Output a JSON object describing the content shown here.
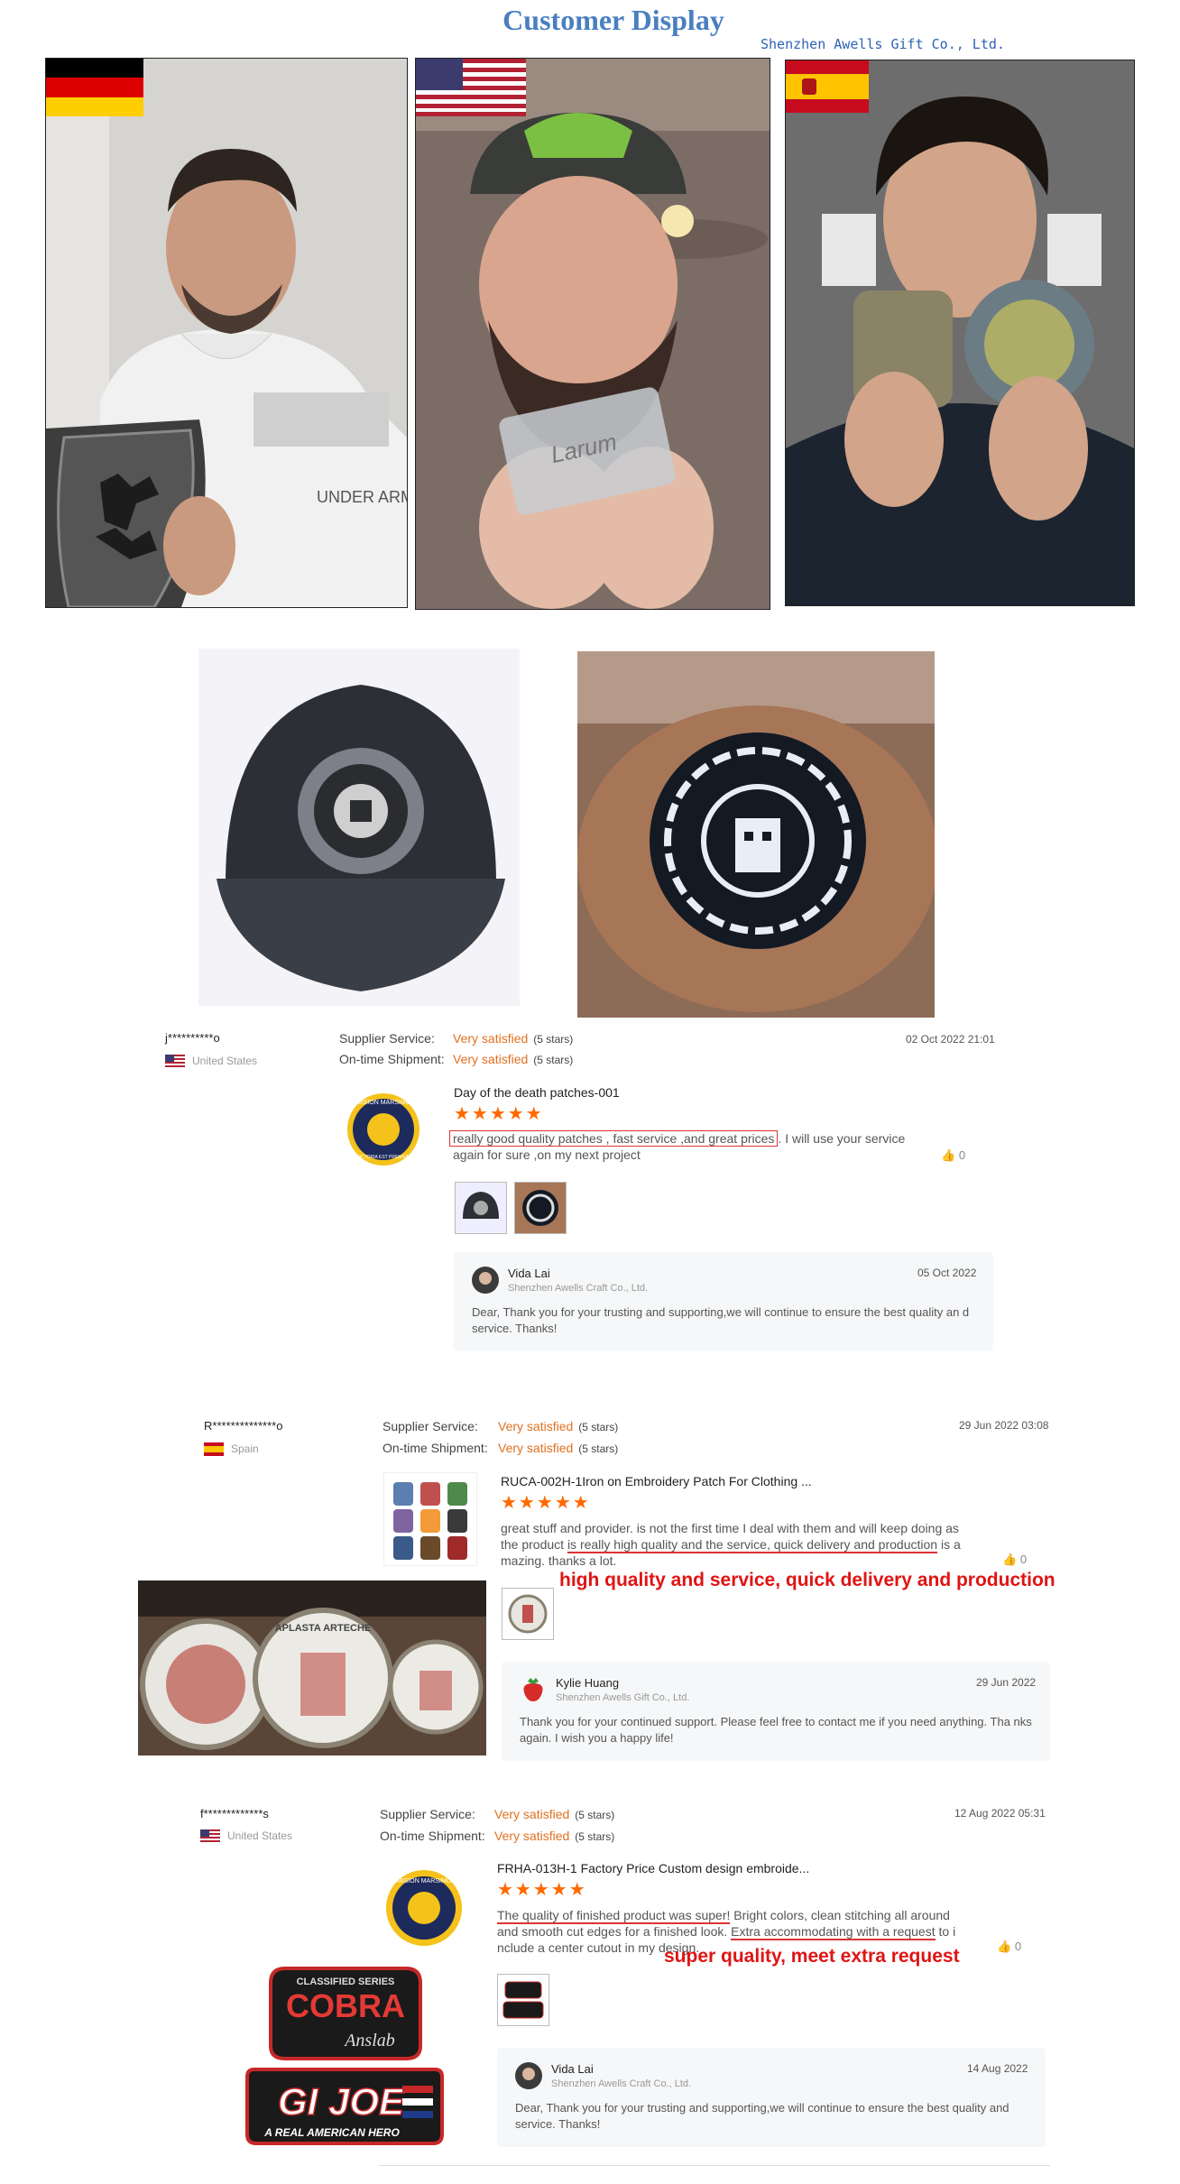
{
  "header": {
    "title": "Customer Display",
    "company": "Shenzhen Awells Gift Co., Ltd."
  },
  "photos": [
    {
      "flag": "germany",
      "shirt_text": "UNDER ARMOUR"
    },
    {
      "flag": "united-states",
      "patch_text": "Larum"
    },
    {
      "flag": "spain"
    }
  ],
  "reviews": [
    {
      "buyer": "j**********o",
      "country": "United States",
      "flag": "united-states",
      "supplier_label": "Supplier Service:",
      "supplier_value": "Very satisfied",
      "supplier_note": "(5 stars)",
      "shipment_label": "On-time Shipment:",
      "shipment_value": "Very satisfied",
      "shipment_note": "(5 stars)",
      "date": "02 Oct 2022 21:01",
      "product": "Day of the death patches-001",
      "stars": "★★★★★",
      "text_highlight": "really good quality patches , fast service ,and great prices",
      "text_rest": ". I will use your  service",
      "text_line2": "again for sure ,on my next project",
      "likes": "0",
      "reply": {
        "name": "Vida Lai",
        "company": "Shenzhen Awells Craft Co., Ltd.",
        "date": "05 Oct 2022",
        "text": "Dear, Thank you for your trusting and supporting,we will continue to ensure the best quality an d service. Thanks!"
      }
    },
    {
      "buyer": "R**************o",
      "country": "Spain",
      "flag": "spain",
      "supplier_label": "Supplier Service:",
      "supplier_value": "Very satisfied",
      "supplier_note": "(5 stars)",
      "shipment_label": "On-time Shipment:",
      "shipment_value": "Very satisfied",
      "shipment_note": "(5 stars)",
      "date": "29 Jun 2022 03:08",
      "product": "RUCA-002H-1Iron on Embroidery Patch For Clothing ...",
      "stars": "★★★★★",
      "text_line1": "great stuff and provider. is not the first time I deal with them and will keep doing as",
      "text_line2_a": "the product ",
      "text_line2_u": "is really high quality and the service, quick delivery and production",
      "text_line2_b": " is a",
      "text_line3": "mazing. thanks a lot.",
      "caption": "high quality and service, quick delivery and production",
      "likes": "0",
      "reply": {
        "name": "Kylie Huang",
        "company": "Shenzhen Awells Gift Co., Ltd.",
        "date": "29 Jun 2022",
        "text": "Thank you for your continued support. Please feel free to contact  me if you need anything. Tha nks again. I wish you a happy life!"
      }
    },
    {
      "buyer": "f*************s",
      "country": "United States",
      "flag": "united-states",
      "supplier_label": "Supplier Service:",
      "supplier_value": "Very satisfied",
      "supplier_note": "(5 stars)",
      "shipment_label": "On-time Shipment:",
      "shipment_value": "Very satisfied",
      "shipment_note": "(5 stars)",
      "date": "12 Aug 2022 05:31",
      "product": "FRHA-013H-1 Factory Price Custom design embroide...",
      "stars": "★★★★★",
      "text_line1_u": "The quality of finished product was super!",
      "text_line1_b": " Bright colors, clean stitching all around",
      "text_line2_a": "and smooth cut edges for a finished look. ",
      "text_line2_u": "Extra accommodating with a request",
      "text_line2_b": " to i",
      "text_line3": "nclude a center cutout in my design.",
      "caption": "super quality, meet extra request",
      "likes": "0",
      "reply": {
        "name": "Vida Lai",
        "company": "Shenzhen Awells Craft Co., Ltd.",
        "date": "14 Aug 2022",
        "text": "Dear, Thank you for your trusting and supporting,we will continue to ensure the best quality and service. Thanks!"
      }
    }
  ],
  "patches": {
    "mission_top": "MISION MARSIMO",
    "mission_bottom": "VICTORIA EST PREMIUM",
    "cobra_top": "CLASSIFIED SERIES",
    "cobra": "COBRA",
    "cobra_sub": "Anslab",
    "gijoe": "GI JOE",
    "gijoe_sub": "A REAL AMERICAN HERO",
    "aplasta": "APLASTA ARTECHE"
  },
  "colors": {
    "accent": "#ff6a00",
    "title": "#4a7fc0",
    "caption": "#e01414"
  }
}
